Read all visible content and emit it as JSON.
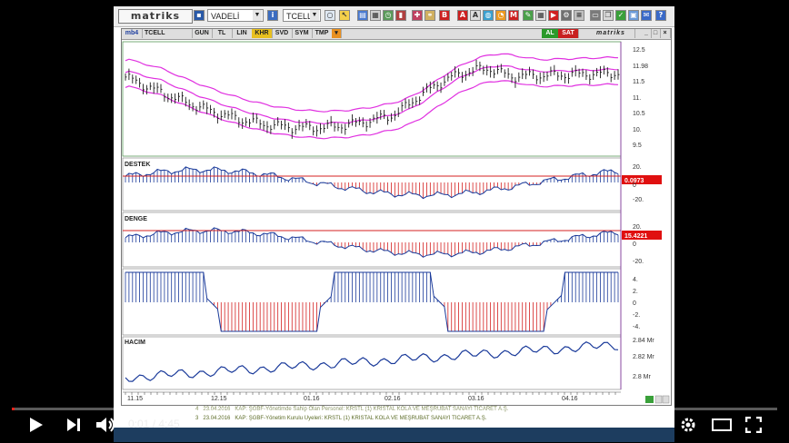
{
  "toolbar": {
    "logo": "matriks",
    "market_select": "VADELİ",
    "symbol_select": "TCELL"
  },
  "chart": {
    "brand": "matriks",
    "tabs": [
      "mb4",
      "TCELL",
      "GUN",
      "TL",
      "LIN",
      "KHR",
      "SVD",
      "SYM",
      "TMP"
    ],
    "buttons": {
      "al": "AL",
      "sat": "SAT"
    },
    "price_axis": [
      "12.5",
      "11.98",
      "11.5",
      "11.",
      "10.5",
      "10.",
      "9.5"
    ],
    "panels": {
      "destek": {
        "label": "DESTEK",
        "value": "0.0973",
        "axis": [
          "20.",
          "0",
          "-20."
        ]
      },
      "denge": {
        "label": "DENGE",
        "value": "15.4221",
        "axis": [
          "20.",
          "0",
          "-20."
        ]
      },
      "momentum": {
        "axis": [
          "4.",
          "2.",
          "0",
          "-2.",
          "-4."
        ]
      },
      "hacim": {
        "label": "HACIM",
        "axis": [
          "2.84 Mr",
          "2.82 Mr",
          "2.8 Mr"
        ]
      }
    },
    "date_axis": [
      "11.15",
      "12.15",
      "01.16",
      "02.16",
      "03.16",
      "04.16"
    ]
  },
  "news": [
    {
      "num": "4",
      "date": "23.04.2016",
      "text": "KAP: ŞGBF-Yönetimde Sahip Olan Personel: KRSTL (1) KRİSTAL KOLA VE MEŞRUBAT SANAYİ TİCARET A.Ş."
    },
    {
      "num": "3",
      "date": "23.04.2016",
      "text": "KAP: ŞGBF-Yönetim Kurulu Üyeleri: KRSTL (1) KRİSTAL KOLA VE MEŞRUBAT SANAYİ TİCARET A.Ş."
    }
  ],
  "player": {
    "current_time": "0:01",
    "separator": " / ",
    "duration": "4:45",
    "progress": 0.004
  },
  "colors": {
    "band": "#e030e0",
    "price_bars": "#1a1a1a",
    "positive": "#1a3a9a",
    "negative": "#d42020",
    "value_box": "#e01010",
    "progress_played": "#e62117",
    "taskbar": "#1d3d5f"
  }
}
